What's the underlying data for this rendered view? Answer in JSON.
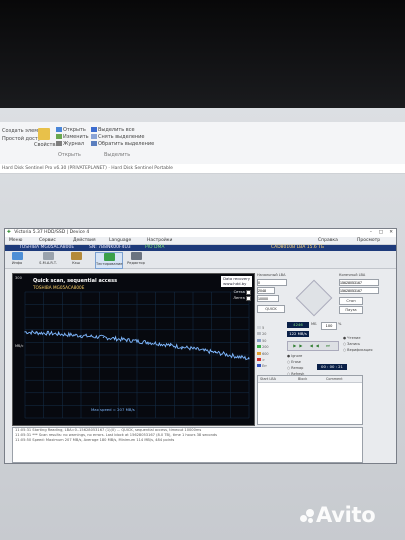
{
  "explorer": {
    "ribbon_left": [
      "Создать элемент",
      "Простой доступ"
    ],
    "open_group": [
      "Открыть",
      "Изменить",
      "Журнал"
    ],
    "properties_label": "Свойства",
    "open_label": "Открыть",
    "select_group": [
      "Выделить все",
      "Снять выделение",
      "Обратить выделение"
    ],
    "select_label": "Выделить",
    "address": "Hard Disk Sentinel Pro v6.30 (PRIVATEPLANET) · Hard Disk Sentinel Portable"
  },
  "victoria": {
    "title": "Victoria 5.37 HDD/SSD | Device 4",
    "menu": [
      "Меню",
      "Сервис",
      "Действия",
      "Language",
      "Настройки",
      "Справка",
      "Просмотр вкладок"
    ],
    "drive_model": "TOSHIBA MG05ACA800E",
    "drive_info": "SN: 7B8NK00F4U3",
    "drive_extra": "PIO  DMA",
    "drive_capacity": "CAD8010B  LBA 15.6 ТБ",
    "toolbar": [
      "Инфо",
      "S.M.A.R.T.",
      "Кэш",
      "Тестирование",
      "Редактор"
    ],
    "chart": {
      "title": "Quick scan, sequential access",
      "subtitle": "TOSHIBA MG05ACA800E",
      "y_top": "300",
      "y_axis_unit": "Мб/с",
      "footer": "Max speed = 207 MB/s",
      "data_recovery": [
        "Data recovery",
        "www.hdd.by"
      ],
      "checks": [
        "Сетка",
        "Лента"
      ]
    },
    "panel": {
      "range_labels": [
        "Начальный LBA",
        "Конечный LBA"
      ],
      "lba_start": "0",
      "lba_end": "15628053167",
      "lba_end2": "15628053167",
      "block": "2048",
      "timeout": "10000",
      "buttons": [
        "Стоп",
        "Пауза",
        "QUICK"
      ],
      "mode_labels": [
        "Чтение",
        "Запись",
        "Верификация"
      ],
      "speed_value": "4246",
      "speed_unit": "МБ",
      "speed2": "100",
      "speed2_unit": "%",
      "rate": "122 MB/s",
      "time": "00 : 00 : 21",
      "grid_cols": [
        "Start LBA",
        "Block",
        "Comment"
      ],
      "counts": [
        "5",
        "20",
        "50",
        "200",
        "600",
        ">",
        "Err"
      ],
      "options": [
        "Ignore",
        "Erase",
        "Remap",
        "Refresh"
      ]
    },
    "log": [
      "11:05:31   Starting Reading, LBA=0..15628053167 (1)(0) ... QUICK, sequential access, timeout 10000ms",
      "11:05:31   *** Scan results: no warnings, no errors. Last block at 15628053167 (8.0 TB), time 1 hours 38 seconds",
      "11:05:50   Speed: Maximum 207 MB/s, Average 180 MB/s, Minimum 114 MB/s, 484 points"
    ]
  },
  "watermark": "Avito",
  "chart_data": {
    "type": "line",
    "title": "Quick scan, sequential access",
    "ylabel": "Мб/с",
    "ylim": [
      0,
      300
    ],
    "x": [
      0,
      5,
      10,
      15,
      20,
      25,
      30,
      35,
      40,
      45,
      50,
      55,
      60,
      65,
      70,
      75,
      80,
      85,
      90,
      95,
      100
    ],
    "series": [
      {
        "values": [
          205,
          203,
          202,
          200,
          198,
          196,
          194,
          192,
          189,
          186,
          183,
          180,
          177,
          173,
          169,
          165,
          160,
          156,
          151,
          146,
          141
        ]
      }
    ],
    "annotations": [
      "Max speed = 207 MB/s"
    ],
    "grid": true
  },
  "colors": {
    "chart_bg": "#07090f",
    "grid": "#16304a",
    "trace": "#7fb8ff",
    "title_bar": "#1d3a7a"
  }
}
